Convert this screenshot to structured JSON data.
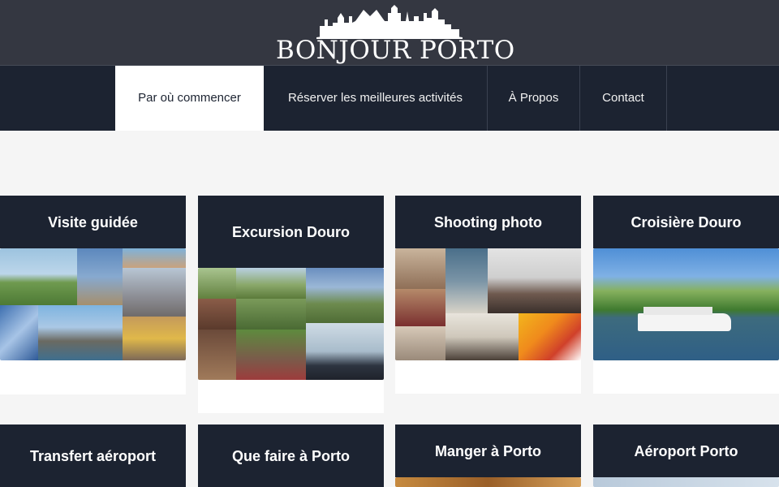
{
  "site": {
    "logo_text": "BONJOUR PORTO"
  },
  "nav": {
    "items": [
      {
        "label": "Par où commencer",
        "active": true
      },
      {
        "label": "Réserver les meilleures activités",
        "active": false
      },
      {
        "label": "À Propos",
        "active": false
      },
      {
        "label": "Contact",
        "active": false
      }
    ]
  },
  "cards": [
    {
      "title": "Visite guidée",
      "image": "collage-porto-landmarks"
    },
    {
      "title": "Excursion Douro",
      "image": "collage-douro-valley"
    },
    {
      "title": "Shooting photo",
      "image": "collage-photo-session"
    },
    {
      "title": "Croisière Douro",
      "image": "douro-river-cruise"
    },
    {
      "title": "Transfert aéroport",
      "image": ""
    },
    {
      "title": "Que faire à Porto",
      "image": ""
    },
    {
      "title": "Manger à Porto",
      "image": "food"
    },
    {
      "title": "Aéroport Porto",
      "image": "airport"
    }
  ]
}
